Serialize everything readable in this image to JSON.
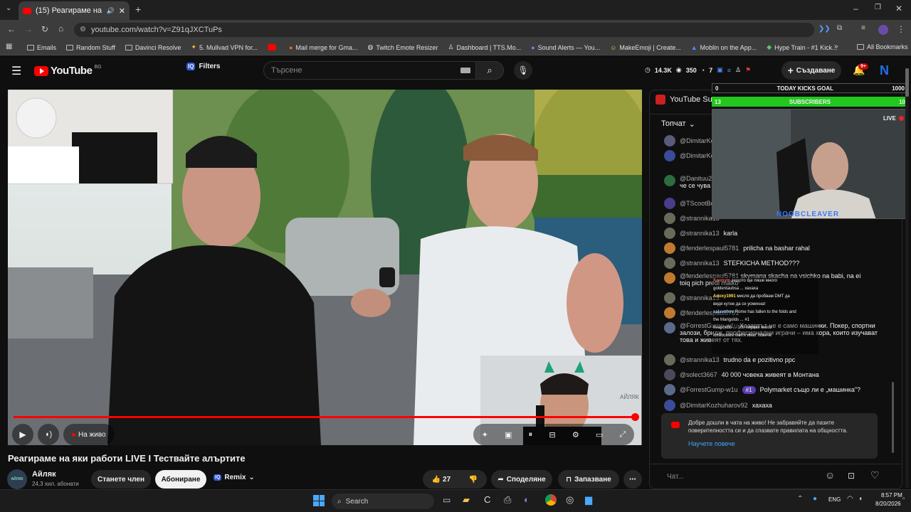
{
  "browser": {
    "tab_title": "(15) Реагираме на яки рабо",
    "url": "youtube.com/watch?v=Z91qJXCTuPs",
    "bookmarks": [
      "Emails",
      "Random Stuff",
      "Davinci Resolve",
      "5. Mullvad VPN for...",
      "",
      "Mail merge for Gma...",
      "Twitch Emote Resizer",
      "Dashboard | TTS.Mo...",
      "Sound Alerts — You...",
      "MakeEmoji | Create...",
      "Moblin on the App...",
      "Hype Train - #1 Kick..."
    ],
    "all_bookmarks": "All Bookmarks"
  },
  "youtube": {
    "logo": "YouTube",
    "country": "BG",
    "filters": "Filters",
    "search_placeholder": "Търсене",
    "stat_views": "14.3K",
    "stat_watching": "350",
    "stat_other": "7",
    "create": "Създаване",
    "notif_badge": "9+",
    "avatar_letter": "N"
  },
  "video": {
    "title": "Реагираме на яки работи LIVE I Тествайте алъртите",
    "live_label": "На живо",
    "channel": "Айляк",
    "subs": "24,3 хил. абонати",
    "channel_avatar_text": "АЙЛЯК",
    "join": "Станете член",
    "subscribe": "Абониране",
    "remix": "Remix",
    "likes": "27",
    "share": "Споделяне",
    "save": "Запазване",
    "progress": 1.0
  },
  "overlay": {
    "goal_start": "0",
    "goal_title": "TODAY KICKS GOAL",
    "goal_end": "1000",
    "subs_start": "13",
    "subs_title": "SUBSCRIBERS",
    "subs_end": "10",
    "live": "LIVE",
    "streamer": "NOOBCLEAVER",
    "yt_title": "YouTube Su",
    "cam_tag": "AЙЛЯК",
    "popup_lines": [
      {
        "user": "Anonym",
        "text": "защото ще пише много"
      },
      {
        "user": "",
        "text": "goldentaubsa ... хахаха"
      },
      {
        "user": "Adoxy1991",
        "text": "мисля да пробвам DMT да"
      },
      {
        "user": "",
        "text": "видя кутне да се усмихнат"
      },
      {
        "user": "salavohev",
        "text": "Rome has fallen to the folds and"
      },
      {
        "user": "",
        "text": "the Marigolds ... #1"
      },
      {
        "user": "",
        "text": "Кнарок88 ... 100 лирики книга"
      },
      {
        "user": "",
        "text": "готвоските книги имат повече"
      }
    ]
  },
  "chat": {
    "filter": "Топчат",
    "messages": [
      {
        "name": "@DimitarKo",
        "text": ""
      },
      {
        "name": "@DimitarKo",
        "text": ""
      },
      {
        "name": "@Danituu2",
        "text": "че се чува"
      },
      {
        "name": "@TScootBo",
        "text": ""
      },
      {
        "name": "@strannika13",
        "text": ""
      },
      {
        "name": "@strannika13",
        "text": "karla"
      },
      {
        "name": "@fenderlespaul5781",
        "text": "prilicha na bashar rahal"
      },
      {
        "name": "@strannika13",
        "text": "STEFKICHA METHOD???"
      },
      {
        "name": "@fenderlespaul5781",
        "text": "skymana skacha na vsichko na babi, na ei toiq pich predi malko"
      },
      {
        "name": "@strannika13",
        "text": ""
      },
      {
        "name": "@fenderlespaul5781",
        "text": ""
      },
      {
        "name": "@ForrestGump-w1u",
        "text": "Хазартът не е само машинки. Покер, спортни залози, бридж, професионални играчи – има хора, които изучават това и живеят от тях."
      },
      {
        "name": "@strannika13",
        "text": "trudno da e pozitivno ppc"
      },
      {
        "name": "@solect3667",
        "text": "40 000 човека живеят в Монтана"
      },
      {
        "name": "@ForrestGump-w1u",
        "text": "Polymarket също ли е „машинка\"?"
      },
      {
        "name": "@DimitarKozhuharov92",
        "text": "хахаха"
      }
    ],
    "badge": "#1",
    "welcome": "Добре дошли в чата на живо! Не забравяйте да пазите поверителността си и да спазвате правилата на общността.",
    "learn_more": "Научете повече",
    "input_placeholder": "Чат..."
  },
  "taskbar": {
    "search": "Search",
    "lang": "ENG",
    "time": "8:57 PM",
    "date": "8/20/2026"
  }
}
